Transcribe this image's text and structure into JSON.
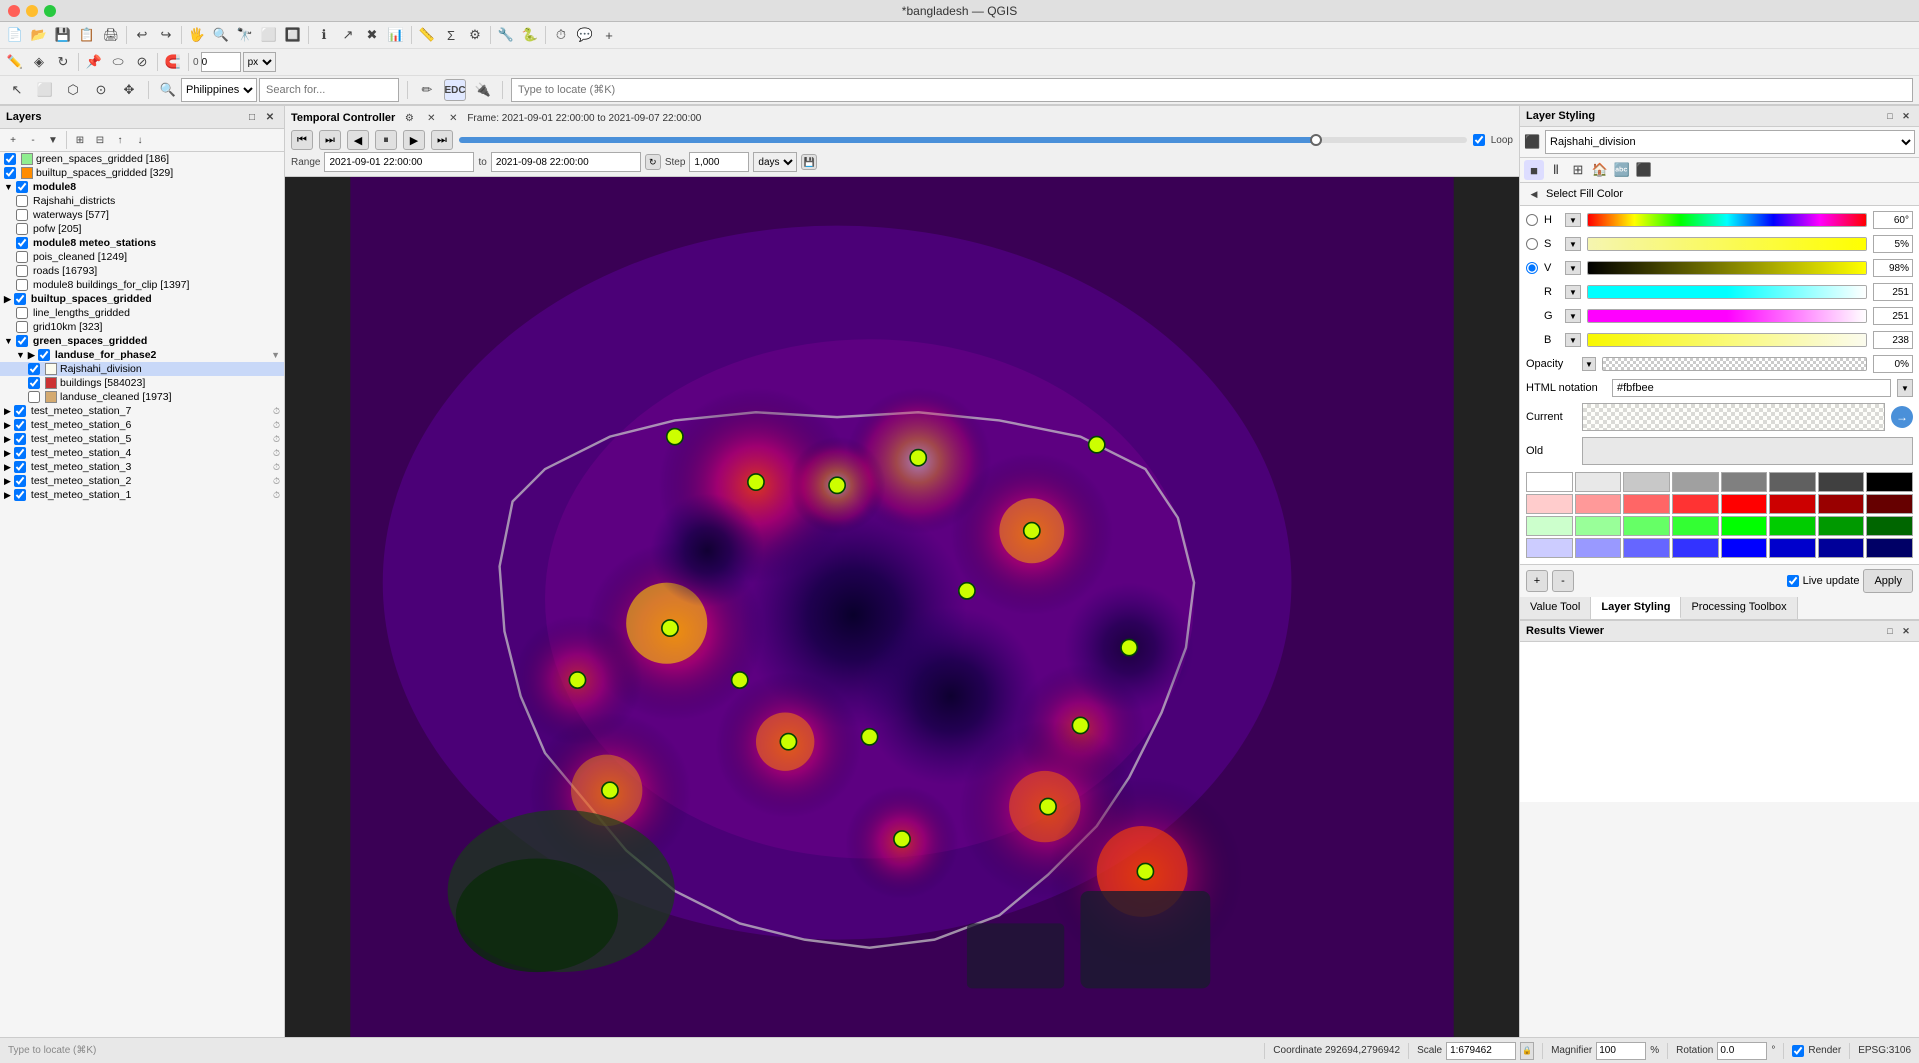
{
  "titlebar": {
    "title": "*bangladesh — QGIS"
  },
  "toolbar": {
    "rows": [
      {
        "id": "row1",
        "icons": [
          "📂",
          "💾",
          "🖨",
          "✂️",
          "📋",
          "↩",
          "↪",
          "🔍",
          "🗺",
          "📐",
          "⚙",
          "🔧"
        ]
      },
      {
        "id": "row2",
        "icons": [
          "✏️",
          "📝",
          "🖊",
          "🔷",
          "🔺",
          "⬡",
          "📌"
        ]
      },
      {
        "id": "row3",
        "icons": [
          "🖱",
          "📦",
          "🔲",
          "📊"
        ]
      }
    ]
  },
  "search_bar": {
    "location_placeholder": "Philippines",
    "search_placeholder": "Search for...",
    "locate_placeholder": "Type to locate (⌘K)"
  },
  "layers_panel": {
    "title": "Layers",
    "items": [
      {
        "id": "green_spaces_gridded",
        "label": "green_spaces_gridded [186]",
        "indent": 0,
        "checked": true,
        "color": "#90ee90",
        "type": "raster"
      },
      {
        "id": "builtup_spaces_gridded",
        "label": "builtup_spaces_gridded [329]",
        "indent": 0,
        "checked": true,
        "color": "#ff8c00",
        "type": "raster"
      },
      {
        "id": "module8",
        "label": "module8",
        "indent": 0,
        "checked": true,
        "type": "group",
        "expanded": true
      },
      {
        "id": "Rajshahi_districts",
        "label": "Rajshahi_districts",
        "indent": 1,
        "checked": false,
        "type": "layer"
      },
      {
        "id": "waterways",
        "label": "waterways [577]",
        "indent": 1,
        "checked": false,
        "type": "layer"
      },
      {
        "id": "pofw",
        "label": "pofw [205]",
        "indent": 1,
        "checked": false,
        "type": "layer"
      },
      {
        "id": "module8_meteo",
        "label": "module8 meteo_stations",
        "indent": 1,
        "checked": true,
        "type": "layer",
        "bold": true
      },
      {
        "id": "pois_cleaned",
        "label": "pois_cleaned [1249]",
        "indent": 1,
        "checked": false,
        "type": "layer"
      },
      {
        "id": "roads",
        "label": "roads [16793]",
        "indent": 1,
        "checked": false,
        "type": "layer"
      },
      {
        "id": "module8_buildings",
        "label": "module8 buildings_for_clip [1397]",
        "indent": 1,
        "checked": false,
        "type": "layer"
      },
      {
        "id": "builtup_spaces_gridded2",
        "label": "builtup_spaces_gridded",
        "indent": 0,
        "checked": true,
        "type": "group",
        "expanded": false
      },
      {
        "id": "line_lengths_gridded",
        "label": "line_lengths_gridded",
        "indent": 1,
        "checked": false,
        "type": "layer"
      },
      {
        "id": "grid10km",
        "label": "grid10km [323]",
        "indent": 1,
        "checked": false,
        "type": "layer"
      },
      {
        "id": "green_spaces_gridded2",
        "label": "green_spaces_gridded",
        "indent": 0,
        "checked": true,
        "type": "group",
        "expanded": true
      },
      {
        "id": "landuse_for_phase2_grp",
        "label": "landuse_for_phase2",
        "indent": 1,
        "checked": true,
        "type": "group",
        "expanded": true
      },
      {
        "id": "Rajshahi_division",
        "label": "Rajshahi_division",
        "indent": 2,
        "checked": true,
        "color": "#fbfbee",
        "type": "layer",
        "selected": true
      },
      {
        "id": "buildings",
        "label": "buildings [584023]",
        "indent": 2,
        "checked": true,
        "color": "#ff4444",
        "type": "layer"
      },
      {
        "id": "landuse_cleaned",
        "label": "landuse_cleaned [1973]",
        "indent": 2,
        "checked": false,
        "color": "#d4aa70",
        "type": "layer"
      },
      {
        "id": "test_meteo_7",
        "label": "test_meteo_station_7",
        "indent": 0,
        "checked": true,
        "type": "layer"
      },
      {
        "id": "test_meteo_6",
        "label": "test_meteo_station_6",
        "indent": 0,
        "checked": true,
        "type": "layer"
      },
      {
        "id": "test_meteo_5",
        "label": "test_meteo_station_5",
        "indent": 0,
        "checked": true,
        "type": "layer"
      },
      {
        "id": "test_meteo_4",
        "label": "test_meteo_station_4",
        "indent": 0,
        "checked": true,
        "type": "layer"
      },
      {
        "id": "test_meteo_3",
        "label": "test_meteo_station_3",
        "indent": 0,
        "checked": true,
        "type": "layer"
      },
      {
        "id": "test_meteo_2",
        "label": "test_meteo_station_2",
        "indent": 0,
        "checked": true,
        "type": "layer"
      },
      {
        "id": "test_meteo_1",
        "label": "test_meteo_station_1",
        "indent": 0,
        "checked": true,
        "type": "layer"
      }
    ]
  },
  "temporal_controller": {
    "title": "Temporal Controller",
    "frame_info": "Frame: 2021-09-01 22:00:00 to 2021-09-07 22:00:00",
    "range_start": "2021-09-01 22:00:00",
    "range_end": "2021-09-08 22:00:00",
    "step": "1,000",
    "step_unit": "days",
    "loop": true
  },
  "right_panel": {
    "title": "Layer Styling",
    "layer_name": "Rajshahi_division",
    "fill_color_title": "Select Fill Color",
    "color_sliders": {
      "H": {
        "label": "H",
        "value": "60°",
        "percent": 17
      },
      "S": {
        "label": "S",
        "value": "5%",
        "percent": 5
      },
      "V": {
        "label": "V",
        "value": "98%",
        "percent": 98
      },
      "R": {
        "label": "R",
        "value": "251",
        "percent": 98
      },
      "G": {
        "label": "G",
        "value": "251",
        "percent": 98
      },
      "B": {
        "label": "B",
        "value": "238",
        "percent": 93
      }
    },
    "opacity": {
      "label": "Opacity",
      "value": "0%",
      "percent": 0
    },
    "html_notation": {
      "label": "HTML notation",
      "value": "#fbfbee"
    },
    "live_update": true,
    "apply_label": "Apply",
    "tabs": [
      {
        "id": "value-tool",
        "label": "Value Tool"
      },
      {
        "id": "layer-styling",
        "label": "Layer Styling"
      },
      {
        "id": "processing-toolbox",
        "label": "Processing Toolbox"
      }
    ],
    "swatches": [
      "#ffffff",
      "#e0e0e0",
      "#c0c0c0",
      "#a0a0a0",
      "#808080",
      "#606060",
      "#404040",
      "#000000",
      "#ffcccc",
      "#ff9999",
      "#ff6666",
      "#ff3333",
      "#ff0000",
      "#cc0000",
      "#990000",
      "#660000",
      "#ccffcc",
      "#99ff99",
      "#66ff66",
      "#33ff33",
      "#00ff00",
      "#00cc00",
      "#009900",
      "#006600",
      "#ccccff",
      "#9999ff",
      "#6666ff",
      "#3333ff",
      "#0000ff",
      "#0000cc",
      "#000099",
      "#000066"
    ]
  },
  "results_viewer": {
    "title": "Results Viewer"
  },
  "statusbar": {
    "coordinate": "Coordinate 292694,2796942",
    "scale_label": "Scale",
    "scale_value": "1:679462",
    "magnifier_label": "Magnifier",
    "magnifier_value": "100%",
    "rotation_label": "Rotation",
    "rotation_value": "0.0 °",
    "render_label": "Render",
    "epsg": "EPSG:3106"
  }
}
